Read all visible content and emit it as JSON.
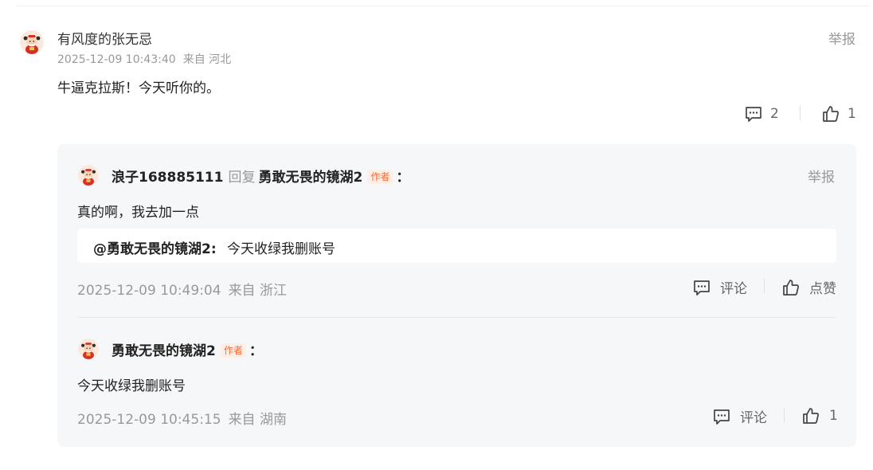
{
  "comment": {
    "username": "有风度的张无忌",
    "timestamp": "2025-12-09 10:43:40",
    "location": "来自 河北",
    "report_label": "举报",
    "text": "牛逼克拉斯！今天听你的。",
    "reply_count": "2",
    "like_count": "1"
  },
  "replies": [
    {
      "username": "浪子168885111",
      "reply_word": "回复",
      "reply_to": "勇敢无畏的镜湖2",
      "badge": "作者",
      "colon": "：",
      "report_label": "举报",
      "text": "真的啊，我去加一点",
      "quote_user": "@勇敢无畏的镜湖2:",
      "quote_text": "今天收绿我删账号",
      "timestamp": "2025-12-09 10:49:04",
      "location": "来自 浙江",
      "comment_label": "评论",
      "like_label": "点赞"
    },
    {
      "username": "勇敢无畏的镜湖2",
      "badge": "作者",
      "colon": "：",
      "text": "今天收绿我删账号",
      "timestamp": "2025-12-09 10:45:15",
      "location": "来自 湖南",
      "comment_label": "评论",
      "like_label": "1"
    }
  ],
  "icons": {
    "avatar": "caishen-avatar-icon",
    "comment": "comment-bubble-icon",
    "like": "thumbs-up-icon"
  },
  "colors": {
    "muted": "#999999",
    "badge_text": "#f26b3a",
    "badge_bg": "#fdeee6",
    "reply_bg": "#f6f7f9"
  }
}
